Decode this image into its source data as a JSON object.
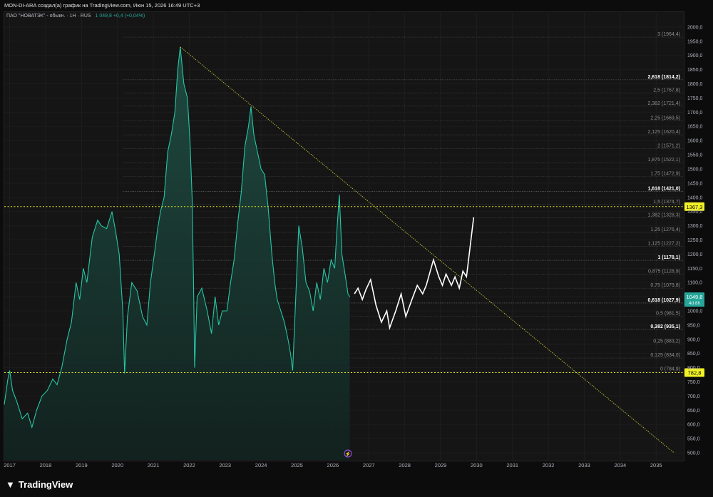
{
  "header": {
    "attribution": "MON-DI-ARA создал(а) график на TradingView.com, Июн 15, 2026 16:49 UTC+3"
  },
  "symbol": {
    "name": "ПАО \"НОВАТЭК\" - обыкн.",
    "interval": "1H",
    "exchange": "RUS",
    "value_text": "1 049,8 +0,4 (+0,04%)"
  },
  "footer": {
    "brand": "TradingView"
  },
  "chart_data": {
    "type": "area",
    "x_axis_labels": [
      "2017",
      "2018",
      "2019",
      "2020",
      "2021",
      "2022",
      "2023",
      "2024",
      "2025",
      "2026",
      "2027",
      "2028",
      "2029",
      "2030",
      "2031",
      "2032",
      "2033",
      "2034",
      "2035"
    ],
    "y_ticks": [
      500,
      550,
      600,
      650,
      700,
      750,
      800,
      850,
      900,
      950,
      1000,
      1050,
      1100,
      1150,
      1200,
      1250,
      1300,
      1350,
      1400,
      1450,
      1500,
      1550,
      1600,
      1650,
      1700,
      1750,
      1800,
      1850,
      1900,
      1950,
      2000
    ],
    "ylim": [
      475,
      2050
    ],
    "xlim": [
      2016.85,
      2035.75
    ],
    "colors": {
      "price_line": "#26c6a6",
      "area_fill": "#1a3b34",
      "projection": "#ffffff",
      "horizontal_levels": "#e5e31a",
      "trendline": "#c8c635",
      "price_badge": "#26a69a",
      "level_badge": "#f2f227"
    },
    "price_series": [
      [
        2016.85,
        670
      ],
      [
        2016.95,
        760
      ],
      [
        2017.0,
        790
      ],
      [
        2017.08,
        720
      ],
      [
        2017.2,
        680
      ],
      [
        2017.35,
        620
      ],
      [
        2017.5,
        640
      ],
      [
        2017.62,
        590
      ],
      [
        2017.75,
        650
      ],
      [
        2017.9,
        700
      ],
      [
        2018.05,
        720
      ],
      [
        2018.2,
        760
      ],
      [
        2018.32,
        740
      ],
      [
        2018.45,
        800
      ],
      [
        2018.6,
        900
      ],
      [
        2018.72,
        960
      ],
      [
        2018.85,
        1100
      ],
      [
        2018.95,
        1040
      ],
      [
        2019.05,
        1150
      ],
      [
        2019.15,
        1100
      ],
      [
        2019.3,
        1260
      ],
      [
        2019.45,
        1320
      ],
      [
        2019.55,
        1300
      ],
      [
        2019.7,
        1290
      ],
      [
        2019.85,
        1350
      ],
      [
        2019.95,
        1280
      ],
      [
        2020.05,
        1200
      ],
      [
        2020.15,
        1000
      ],
      [
        2020.2,
        780
      ],
      [
        2020.28,
        980
      ],
      [
        2020.4,
        1100
      ],
      [
        2020.55,
        1070
      ],
      [
        2020.7,
        980
      ],
      [
        2020.82,
        950
      ],
      [
        2020.92,
        1100
      ],
      [
        2021.05,
        1220
      ],
      [
        2021.12,
        1290
      ],
      [
        2021.2,
        1350
      ],
      [
        2021.3,
        1400
      ],
      [
        2021.4,
        1560
      ],
      [
        2021.5,
        1620
      ],
      [
        2021.6,
        1700
      ],
      [
        2021.68,
        1850
      ],
      [
        2021.75,
        1930
      ],
      [
        2021.85,
        1800
      ],
      [
        2021.95,
        1750
      ],
      [
        2022.02,
        1600
      ],
      [
        2022.08,
        1400
      ],
      [
        2022.12,
        1100
      ],
      [
        2022.15,
        800
      ],
      [
        2022.22,
        1050
      ],
      [
        2022.35,
        1080
      ],
      [
        2022.5,
        1000
      ],
      [
        2022.62,
        920
      ],
      [
        2022.72,
        1050
      ],
      [
        2022.82,
        950
      ],
      [
        2022.92,
        1000
      ],
      [
        2023.05,
        1000
      ],
      [
        2023.15,
        1100
      ],
      [
        2023.25,
        1180
      ],
      [
        2023.35,
        1310
      ],
      [
        2023.45,
        1420
      ],
      [
        2023.55,
        1580
      ],
      [
        2023.65,
        1650
      ],
      [
        2023.72,
        1720
      ],
      [
        2023.8,
        1620
      ],
      [
        2023.9,
        1560
      ],
      [
        2024.0,
        1500
      ],
      [
        2024.1,
        1480
      ],
      [
        2024.2,
        1360
      ],
      [
        2024.3,
        1200
      ],
      [
        2024.38,
        1100
      ],
      [
        2024.45,
        1040
      ],
      [
        2024.55,
        1000
      ],
      [
        2024.65,
        960
      ],
      [
        2024.75,
        900
      ],
      [
        2024.82,
        850
      ],
      [
        2024.88,
        790
      ],
      [
        2024.95,
        1000
      ],
      [
        2025.05,
        1300
      ],
      [
        2025.15,
        1220
      ],
      [
        2025.25,
        1100
      ],
      [
        2025.35,
        1070
      ],
      [
        2025.45,
        1000
      ],
      [
        2025.55,
        1100
      ],
      [
        2025.65,
        1040
      ],
      [
        2025.75,
        1150
      ],
      [
        2025.85,
        1100
      ],
      [
        2025.95,
        1180
      ],
      [
        2026.05,
        1150
      ],
      [
        2026.12,
        1300
      ],
      [
        2026.18,
        1410
      ],
      [
        2026.25,
        1200
      ],
      [
        2026.35,
        1120
      ],
      [
        2026.42,
        1060
      ],
      [
        2026.47,
        1049.8
      ]
    ],
    "projection_path": [
      [
        2026.6,
        1060
      ],
      [
        2026.7,
        1080
      ],
      [
        2026.82,
        1040
      ],
      [
        2026.92,
        1075
      ],
      [
        2027.05,
        1110
      ],
      [
        2027.2,
        1020
      ],
      [
        2027.35,
        960
      ],
      [
        2027.5,
        1000
      ],
      [
        2027.58,
        940
      ],
      [
        2027.75,
        1000
      ],
      [
        2027.9,
        1060
      ],
      [
        2028.03,
        980
      ],
      [
        2028.2,
        1040
      ],
      [
        2028.35,
        1090
      ],
      [
        2028.5,
        1060
      ],
      [
        2028.6,
        1090
      ],
      [
        2028.8,
        1180
      ],
      [
        2028.95,
        1120
      ],
      [
        2029.05,
        1090
      ],
      [
        2029.15,
        1130
      ],
      [
        2029.3,
        1090
      ],
      [
        2029.4,
        1120
      ],
      [
        2029.52,
        1080
      ],
      [
        2029.62,
        1140
      ],
      [
        2029.72,
        1120
      ],
      [
        2029.92,
        1330
      ]
    ],
    "trendline": {
      "from": [
        2021.75,
        1930
      ],
      "to": [
        2035.5,
        500
      ]
    },
    "horizontal_levels": [
      {
        "y": 1367.3,
        "label": "1367,3"
      },
      {
        "y": 782.8,
        "label": "782,8"
      }
    ],
    "fib_levels": [
      {
        "ratio": 3,
        "y": 1964.4,
        "label": "3 (1964,4)",
        "major": false
      },
      {
        "ratio": 2.618,
        "y": 1814.2,
        "label": "2,618 (1814,2)",
        "major": true
      },
      {
        "ratio": 2.5,
        "y": 1767.8,
        "label": "2,5 (1767,8)",
        "major": false
      },
      {
        "ratio": 2.382,
        "y": 1721.4,
        "label": "2,382 (1721,4)",
        "major": false
      },
      {
        "ratio": 2.25,
        "y": 1669.5,
        "label": "2,25 (1669,5)",
        "major": false
      },
      {
        "ratio": 2.125,
        "y": 1620.4,
        "label": "2,125 (1620,4)",
        "major": false
      },
      {
        "ratio": 2,
        "y": 1571.2,
        "label": "2 (1571,2)",
        "major": false
      },
      {
        "ratio": 1.875,
        "y": 1522.1,
        "label": "1,875 (1522,1)",
        "major": false
      },
      {
        "ratio": 1.75,
        "y": 1472.9,
        "label": "1,75 (1472,9)",
        "major": false
      },
      {
        "ratio": 1.618,
        "y": 1421.0,
        "label": "1,618 (1421,0)",
        "major": true
      },
      {
        "ratio": 1.5,
        "y": 1374.7,
        "label": "1,5 (1374,7)",
        "major": false
      },
      {
        "ratio": 1.382,
        "y": 1328.3,
        "label": "1,382 (1328,3)",
        "major": false
      },
      {
        "ratio": 1.25,
        "y": 1276.4,
        "label": "1,25 (1276,4)",
        "major": false
      },
      {
        "ratio": 1.125,
        "y": 1227.2,
        "label": "1,125 (1227,2)",
        "major": false
      },
      {
        "ratio": 1,
        "y": 1178.1,
        "label": "1 (1178,1)",
        "major": true
      },
      {
        "ratio": 0.875,
        "y": 1128.9,
        "label": "0,875 (1128,9)",
        "major": false
      },
      {
        "ratio": 0.75,
        "y": 1079.8,
        "label": "0,75 (1079,8)",
        "major": false
      },
      {
        "ratio": 0.618,
        "y": 1027.9,
        "label": "0,618 (1027,9)",
        "major": true
      },
      {
        "ratio": 0.5,
        "y": 981.5,
        "label": "0,5 (981,5)",
        "major": false
      },
      {
        "ratio": 0.382,
        "y": 935.1,
        "label": "0,382 (935,1)",
        "major": true
      },
      {
        "ratio": 0.25,
        "y": 883.2,
        "label": "0,25 (883,2)",
        "major": false
      },
      {
        "ratio": 0.125,
        "y": 834.0,
        "label": "0,125 (834,0)",
        "major": false
      },
      {
        "ratio": 0,
        "y": 784.9,
        "label": "0 (784,9)",
        "major": false
      }
    ],
    "fib_start_x": 2020.15,
    "last_price": {
      "value": 1049.8,
      "label": "1049,8",
      "sublabel": "4d 8h"
    }
  }
}
